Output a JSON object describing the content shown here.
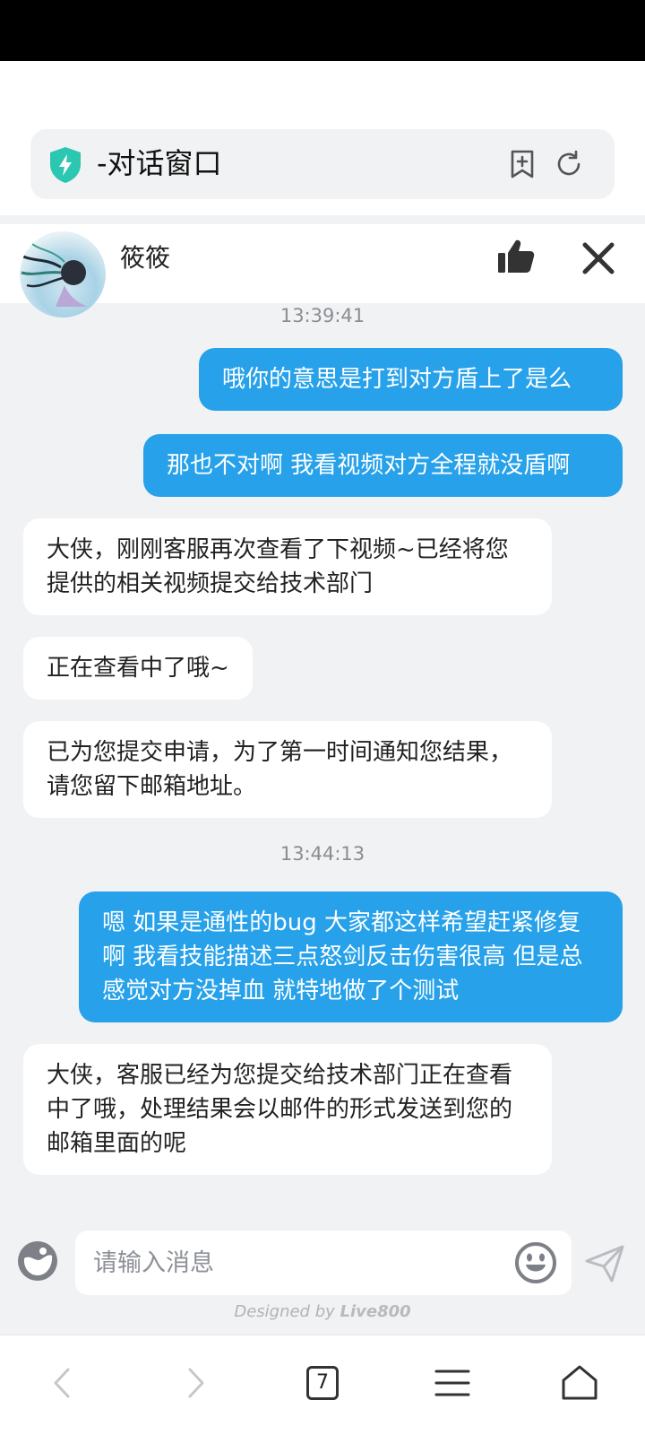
{
  "browser": {
    "page_title": "-对话窗口",
    "tab_count": "7"
  },
  "chat": {
    "agent_name": "筱筱"
  },
  "messages": [
    {
      "type": "timestamp",
      "text": "13:39:41"
    },
    {
      "type": "me",
      "text": "哦你的意思是打到对方盾上了是么"
    },
    {
      "type": "me",
      "text": "那也不对啊 我看视频对方全程就没盾啊"
    },
    {
      "type": "agent",
      "text": "大侠，刚刚客服再次查看了下视频~已经将您提供的相关视频提交给技术部门"
    },
    {
      "type": "agent",
      "text": "正在查看中了哦~"
    },
    {
      "type": "agent",
      "text": "已为您提交申请，为了第一时间通知您结果，请您留下邮箱地址。"
    },
    {
      "type": "timestamp",
      "text": "13:44:13"
    },
    {
      "type": "me",
      "text": "嗯 如果是通性的bug 大家都这样希望赶紧修复啊 我看技能描述三点怒剑反击伤害很高 但是总感觉对方没掉血 就特地做了个测试"
    },
    {
      "type": "agent",
      "text": "大侠，客服已经为您提交给技术部门正在查看中了哦，处理结果会以邮件的形式发送到您的邮箱里面的呢"
    }
  ],
  "composer": {
    "placeholder": "请输入消息"
  },
  "footer": {
    "designed_by_prefix": "Designed by",
    "designed_by_brand": "Live800"
  },
  "colors": {
    "my_bubble": "#27a1ea",
    "agent_bubble": "#ffffff",
    "background": "#f1f2f4",
    "shield": "#2bc7b0"
  }
}
